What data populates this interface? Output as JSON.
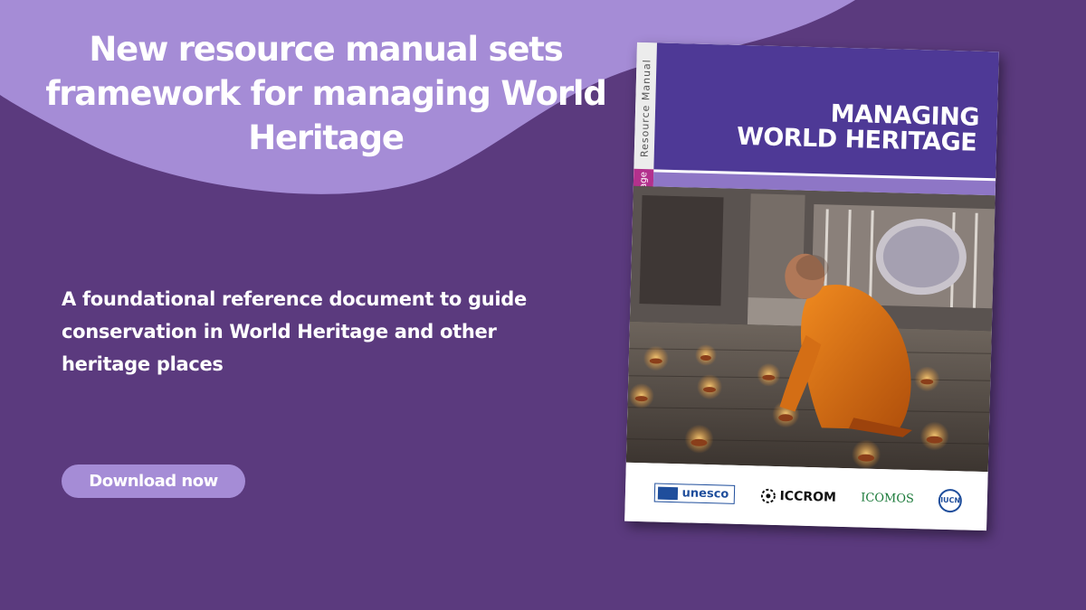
{
  "headline": "New resource manual sets framework for managing World Heritage",
  "subtitle": "A foundational reference document to guide conservation in World Heritage and other heritage places",
  "download_button": "Download now",
  "book": {
    "spine_label": "Resource Manual",
    "spine_tag": "World Heritage",
    "title_line1": "MANAGING",
    "title_line2": "WORLD HERITAGE",
    "logos": {
      "unesco": "unesco",
      "iccrom": "ICCROM",
      "icomos": "ICOMOS",
      "iucn": "IUCN"
    }
  },
  "colors": {
    "background": "#5b3a7e",
    "wave": "#a58cd6",
    "book_title_band": "#4e3996",
    "spine_tag": "#b3318d"
  }
}
